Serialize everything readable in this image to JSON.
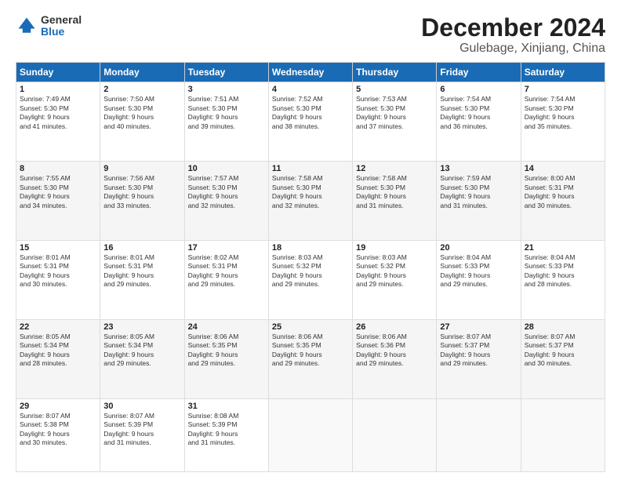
{
  "logo": {
    "general": "General",
    "blue": "Blue"
  },
  "header": {
    "month": "December 2024",
    "location": "Gulebage, Xinjiang, China"
  },
  "days_of_week": [
    "Sunday",
    "Monday",
    "Tuesday",
    "Wednesday",
    "Thursday",
    "Friday",
    "Saturday"
  ],
  "weeks": [
    [
      {
        "day": "1",
        "info": "Sunrise: 7:49 AM\nSunset: 5:30 PM\nDaylight: 9 hours\nand 41 minutes."
      },
      {
        "day": "2",
        "info": "Sunrise: 7:50 AM\nSunset: 5:30 PM\nDaylight: 9 hours\nand 40 minutes."
      },
      {
        "day": "3",
        "info": "Sunrise: 7:51 AM\nSunset: 5:30 PM\nDaylight: 9 hours\nand 39 minutes."
      },
      {
        "day": "4",
        "info": "Sunrise: 7:52 AM\nSunset: 5:30 PM\nDaylight: 9 hours\nand 38 minutes."
      },
      {
        "day": "5",
        "info": "Sunrise: 7:53 AM\nSunset: 5:30 PM\nDaylight: 9 hours\nand 37 minutes."
      },
      {
        "day": "6",
        "info": "Sunrise: 7:54 AM\nSunset: 5:30 PM\nDaylight: 9 hours\nand 36 minutes."
      },
      {
        "day": "7",
        "info": "Sunrise: 7:54 AM\nSunset: 5:30 PM\nDaylight: 9 hours\nand 35 minutes."
      }
    ],
    [
      {
        "day": "8",
        "info": "Sunrise: 7:55 AM\nSunset: 5:30 PM\nDaylight: 9 hours\nand 34 minutes."
      },
      {
        "day": "9",
        "info": "Sunrise: 7:56 AM\nSunset: 5:30 PM\nDaylight: 9 hours\nand 33 minutes."
      },
      {
        "day": "10",
        "info": "Sunrise: 7:57 AM\nSunset: 5:30 PM\nDaylight: 9 hours\nand 32 minutes."
      },
      {
        "day": "11",
        "info": "Sunrise: 7:58 AM\nSunset: 5:30 PM\nDaylight: 9 hours\nand 32 minutes."
      },
      {
        "day": "12",
        "info": "Sunrise: 7:58 AM\nSunset: 5:30 PM\nDaylight: 9 hours\nand 31 minutes."
      },
      {
        "day": "13",
        "info": "Sunrise: 7:59 AM\nSunset: 5:30 PM\nDaylight: 9 hours\nand 31 minutes."
      },
      {
        "day": "14",
        "info": "Sunrise: 8:00 AM\nSunset: 5:31 PM\nDaylight: 9 hours\nand 30 minutes."
      }
    ],
    [
      {
        "day": "15",
        "info": "Sunrise: 8:01 AM\nSunset: 5:31 PM\nDaylight: 9 hours\nand 30 minutes."
      },
      {
        "day": "16",
        "info": "Sunrise: 8:01 AM\nSunset: 5:31 PM\nDaylight: 9 hours\nand 29 minutes."
      },
      {
        "day": "17",
        "info": "Sunrise: 8:02 AM\nSunset: 5:31 PM\nDaylight: 9 hours\nand 29 minutes."
      },
      {
        "day": "18",
        "info": "Sunrise: 8:03 AM\nSunset: 5:32 PM\nDaylight: 9 hours\nand 29 minutes."
      },
      {
        "day": "19",
        "info": "Sunrise: 8:03 AM\nSunset: 5:32 PM\nDaylight: 9 hours\nand 29 minutes."
      },
      {
        "day": "20",
        "info": "Sunrise: 8:04 AM\nSunset: 5:33 PM\nDaylight: 9 hours\nand 29 minutes."
      },
      {
        "day": "21",
        "info": "Sunrise: 8:04 AM\nSunset: 5:33 PM\nDaylight: 9 hours\nand 28 minutes."
      }
    ],
    [
      {
        "day": "22",
        "info": "Sunrise: 8:05 AM\nSunset: 5:34 PM\nDaylight: 9 hours\nand 28 minutes."
      },
      {
        "day": "23",
        "info": "Sunrise: 8:05 AM\nSunset: 5:34 PM\nDaylight: 9 hours\nand 29 minutes."
      },
      {
        "day": "24",
        "info": "Sunrise: 8:06 AM\nSunset: 5:35 PM\nDaylight: 9 hours\nand 29 minutes."
      },
      {
        "day": "25",
        "info": "Sunrise: 8:06 AM\nSunset: 5:35 PM\nDaylight: 9 hours\nand 29 minutes."
      },
      {
        "day": "26",
        "info": "Sunrise: 8:06 AM\nSunset: 5:36 PM\nDaylight: 9 hours\nand 29 minutes."
      },
      {
        "day": "27",
        "info": "Sunrise: 8:07 AM\nSunset: 5:37 PM\nDaylight: 9 hours\nand 29 minutes."
      },
      {
        "day": "28",
        "info": "Sunrise: 8:07 AM\nSunset: 5:37 PM\nDaylight: 9 hours\nand 30 minutes."
      }
    ],
    [
      {
        "day": "29",
        "info": "Sunrise: 8:07 AM\nSunset: 5:38 PM\nDaylight: 9 hours\nand 30 minutes."
      },
      {
        "day": "30",
        "info": "Sunrise: 8:07 AM\nSunset: 5:39 PM\nDaylight: 9 hours\nand 31 minutes."
      },
      {
        "day": "31",
        "info": "Sunrise: 8:08 AM\nSunset: 5:39 PM\nDaylight: 9 hours\nand 31 minutes."
      },
      {
        "day": "",
        "info": ""
      },
      {
        "day": "",
        "info": ""
      },
      {
        "day": "",
        "info": ""
      },
      {
        "day": "",
        "info": ""
      }
    ]
  ]
}
